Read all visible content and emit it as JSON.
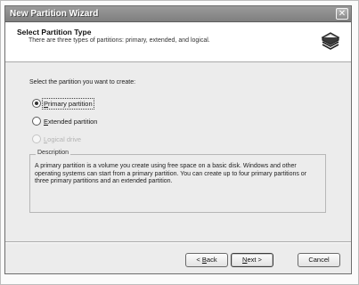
{
  "window": {
    "title": "New Partition Wizard"
  },
  "header": {
    "title": "Select Partition Type",
    "subtitle": "There are three types of partitions: primary, extended, and logical.",
    "icon": "disk-stack-icon"
  },
  "body": {
    "prompt": "Select the partition you want to create:",
    "options": [
      {
        "label": "Primary partition",
        "mnemonic": "P",
        "rest": "rimary partition",
        "selected": true,
        "enabled": true
      },
      {
        "label": "Extended partition",
        "mnemonic": "E",
        "rest": "xtended partition",
        "selected": false,
        "enabled": true
      },
      {
        "label": "Logical drive",
        "mnemonic": "L",
        "rest": "ogical drive",
        "selected": false,
        "enabled": false
      }
    ],
    "description_title": "Description",
    "description_text": "A primary partition is a volume you create using free space on a basic disk. Windows and other operating systems can start from a primary partition. You can create up to four primary partitions or three primary partitions and an extended partition."
  },
  "buttons": {
    "back": {
      "prefix": "< ",
      "mnemonic": "B",
      "rest": "ack"
    },
    "next": {
      "mnemonic": "N",
      "rest": "ext >"
    },
    "cancel": "Cancel"
  }
}
